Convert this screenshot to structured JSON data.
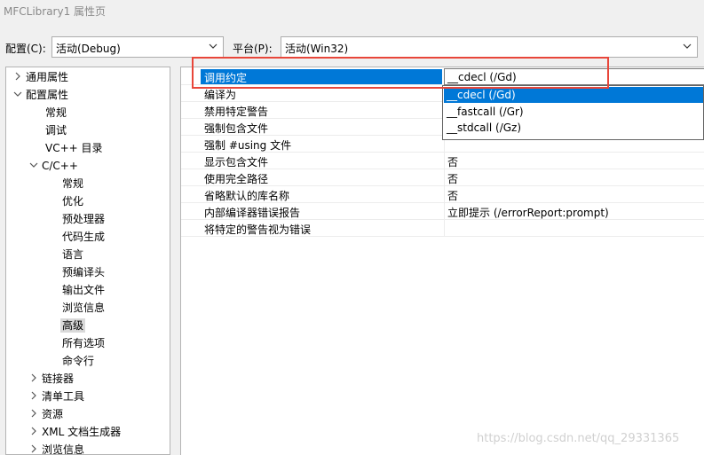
{
  "window": {
    "title": "MFCLibrary1 属性页"
  },
  "config_bar": {
    "config_label": "配置(C):",
    "config_value": "活动(Debug)",
    "platform_label": "平台(P):",
    "platform_value": "活动(Win32)"
  },
  "tree": {
    "items": [
      {
        "label": "通用属性",
        "state": "collapsed"
      },
      {
        "label": "配置属性",
        "state": "expanded"
      },
      {
        "label": "常规"
      },
      {
        "label": "调试"
      },
      {
        "label": "VC++ 目录"
      },
      {
        "label": "C/C++",
        "state": "expanded"
      },
      {
        "label": "常规"
      },
      {
        "label": "优化"
      },
      {
        "label": "预处理器"
      },
      {
        "label": "代码生成"
      },
      {
        "label": "语言"
      },
      {
        "label": "预编译头"
      },
      {
        "label": "输出文件"
      },
      {
        "label": "浏览信息"
      },
      {
        "label": "高级",
        "selected": true
      },
      {
        "label": "所有选项"
      },
      {
        "label": "命令行"
      },
      {
        "label": "链接器",
        "state": "collapsed"
      },
      {
        "label": "清单工具",
        "state": "collapsed"
      },
      {
        "label": "资源",
        "state": "collapsed"
      },
      {
        "label": "XML 文档生成器",
        "state": "collapsed"
      },
      {
        "label": "浏览信息",
        "state": "collapsed"
      }
    ]
  },
  "grid": {
    "rows": [
      {
        "name": "调用约定",
        "value": "__cdecl (/Gd)",
        "selected": true
      },
      {
        "name": "编译为",
        "value": ""
      },
      {
        "name": "禁用特定警告",
        "value": ""
      },
      {
        "name": "强制包含文件",
        "value": ""
      },
      {
        "name": "强制 #using 文件",
        "value": ""
      },
      {
        "name": "显示包含文件",
        "value": "否"
      },
      {
        "name": "使用完全路径",
        "value": "否"
      },
      {
        "name": "省略默认的库名称",
        "value": "否"
      },
      {
        "name": "内部编译器错误报告",
        "value": "立即提示 (/errorReport:prompt)"
      },
      {
        "name": "将特定的警告视为错误",
        "value": ""
      }
    ]
  },
  "dropdown": {
    "options": [
      "__cdecl (/Gd)",
      "__fastcall (/Gr)",
      "__stdcall (/Gz)"
    ],
    "highlighted_index": 0
  },
  "watermark": "https://blog.csdn.net/qq_29331365",
  "colors": {
    "selection": "#0078d7",
    "annotation": "#e8463a"
  }
}
